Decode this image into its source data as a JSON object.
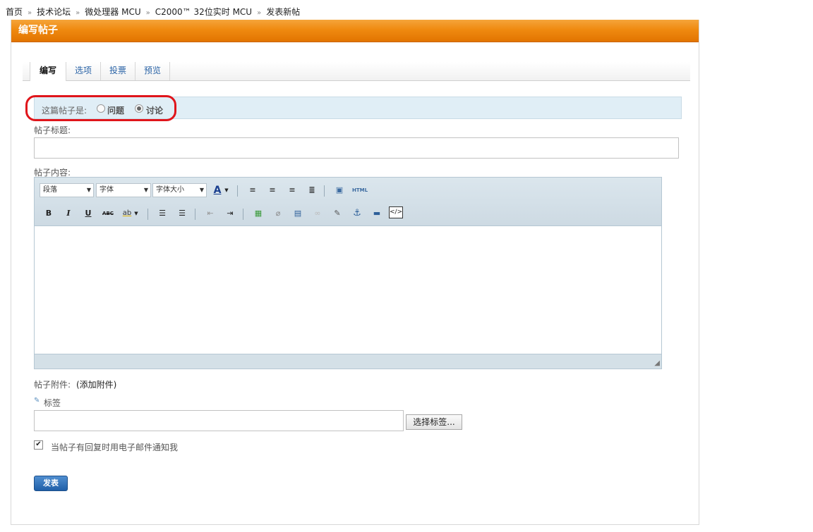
{
  "breadcrumb": [
    "首页",
    "技术论坛",
    "微处理器 MCU",
    "C2000™ 32位实时 MCU",
    "发表新帖"
  ],
  "breadcrumb_sep": "»",
  "panel": {
    "title": "编写帖子"
  },
  "tabs": [
    {
      "label": "编写",
      "active": true
    },
    {
      "label": "选项"
    },
    {
      "label": "投票"
    },
    {
      "label": "预览"
    }
  ],
  "post_type": {
    "label": "这篇帖子是:",
    "options": [
      {
        "label": "问题",
        "checked": false
      },
      {
        "label": "讨论",
        "checked": true
      }
    ]
  },
  "title_field": {
    "label": "帖子标题:",
    "value": ""
  },
  "content_field": {
    "label": "帖子内容:"
  },
  "editor": {
    "paragraph_select": "段落",
    "font_select": "字体",
    "size_select": "字体大小",
    "html_label": "HTML"
  },
  "attachments": {
    "label": "帖子附件:",
    "link": "(添加附件)"
  },
  "tags": {
    "label": "标签",
    "value": "",
    "select_button": "选择标签..."
  },
  "notify": {
    "label": "当帖子有回复时用电子邮件通知我",
    "checked": true
  },
  "submit_label": "发表",
  "colors": {
    "header": "#ef8a10",
    "accent": "#2a63a6",
    "highlight": "#e0151b"
  }
}
